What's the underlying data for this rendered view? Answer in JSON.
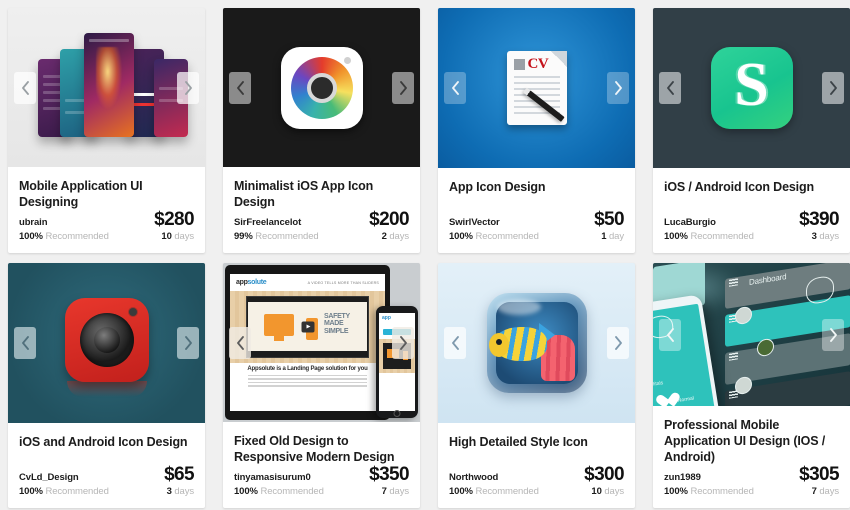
{
  "page": {
    "background_color": "#f0f0f0",
    "recommended_label": "Recommended"
  },
  "cards": [
    {
      "title": "Mobile Application UI Designing",
      "seller": "ubrain",
      "recommended_pct": "100%",
      "recommended_label": "Recommended",
      "price": "$280",
      "delivery_value": "10",
      "delivery_unit": "days",
      "thumbnail": "mobile-app-screens-fan",
      "prev_label": "‹",
      "next_label": "›"
    },
    {
      "title": "Minimalist iOS App Icon Design",
      "seller": "SirFreelancelot",
      "recommended_pct": "99%",
      "recommended_label": "Recommended",
      "price": "$200",
      "delivery_value": "2",
      "delivery_unit": "days",
      "thumbnail": "rainbow-camera-app-icon",
      "prev_label": "‹",
      "next_label": "›"
    },
    {
      "title": "App Icon Design",
      "seller": "SwirlVector",
      "recommended_pct": "100%",
      "recommended_label": "Recommended",
      "price": "$50",
      "delivery_value": "1",
      "delivery_unit": "day",
      "thumbnail": "cv-document-pen-icon",
      "prev_label": "‹",
      "next_label": "›"
    },
    {
      "title": "iOS / Android Icon Design",
      "seller": "LucaBurgio",
      "recommended_pct": "100%",
      "recommended_label": "Recommended",
      "price": "$390",
      "delivery_value": "3",
      "delivery_unit": "days",
      "thumbnail": "green-s-bubble-app-icon",
      "prev_label": "‹",
      "next_label": "›"
    },
    {
      "title": "iOS and Android Icon Design",
      "seller": "CvLd_Design",
      "recommended_pct": "100%",
      "recommended_label": "Recommended",
      "price": "$65",
      "delivery_value": "3",
      "delivery_unit": "days",
      "thumbnail": "red-camera-app-icon",
      "prev_label": "‹",
      "next_label": "›"
    },
    {
      "title": "Fixed Old Design to Responsive Modern Design",
      "seller": "tinyamasisurum0",
      "recommended_pct": "100%",
      "recommended_label": "Recommended",
      "price": "$350",
      "delivery_value": "7",
      "delivery_unit": "days",
      "thumbnail": "responsive-website-mockup",
      "prev_label": "‹",
      "next_label": "›",
      "art_text": {
        "logo_prefix": "app",
        "logo_suffix": "solute",
        "headline": "A VIDEO TELLS MORE THAN SLIDERS",
        "video_text": "SAFETY MADE SIMPLE",
        "caption": "Appsolute is a Landing Page solution for you"
      }
    },
    {
      "title": "High Detailed Style Icon",
      "seller": "Northwood",
      "recommended_pct": "100%",
      "recommended_label": "Recommended",
      "price": "$300",
      "delivery_value": "10",
      "delivery_unit": "days",
      "thumbnail": "aquarium-fish-coral-icon",
      "prev_label": "‹",
      "next_label": "›"
    },
    {
      "title": "Professional Mobile Application UI Design (IOS / Android)",
      "seller": "zun1989",
      "recommended_pct": "100%",
      "recommended_label": "Recommended",
      "price": "$305",
      "delivery_value": "7",
      "delivery_unit": "days",
      "thumbnail": "mobile-ui-dashboard-mockup",
      "prev_label": "‹",
      "next_label": "›",
      "art_text": {
        "dashboard_label": "Dashboard",
        "vitals_label": "Vitals",
        "status_label": "Normal"
      }
    }
  ]
}
